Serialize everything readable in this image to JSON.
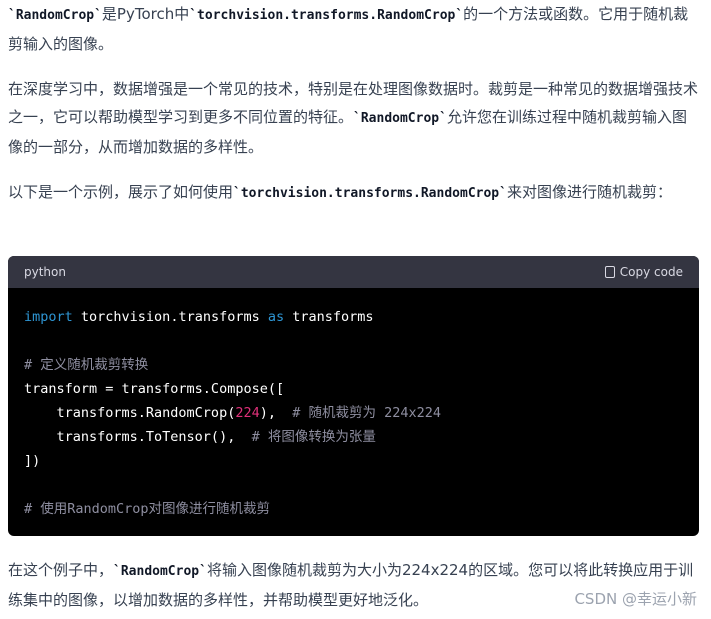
{
  "paragraph1": {
    "code1": "`RandomCrop`",
    "text1": "是PyTorch中",
    "code2": "`torchvision.transforms.RandomCrop`",
    "text2": "的一个方法或函数。它用于随机裁剪输入的图像。"
  },
  "paragraph2": {
    "text1": "在深度学习中，数据增强是一个常见的技术，特别是在处理图像数据时。裁剪是一种常见的数据增强技术之一，它可以帮助模型学习到更多不同位置的特征。",
    "code1": "`RandomCrop`",
    "text2": "允许您在训练过程中随机裁剪输入图像的一部分，从而增加数据的多样性。"
  },
  "paragraph3": {
    "text1": "以下是一个示例，展示了如何使用",
    "code1": "`torchvision.transforms.RandomCrop`",
    "text2": "来对图像进行随机裁剪："
  },
  "code_block": {
    "language": "python",
    "copy_label": "Copy code",
    "lines": {
      "l1": {
        "kw1": "import",
        "mid": " torchvision.transforms ",
        "kw2": "as",
        "end": " transforms"
      },
      "l2": "",
      "l3": {
        "comment": "# 定义随机裁剪转换"
      },
      "l4": {
        "text": "transform = transforms.Compose(["
      },
      "l5": {
        "pre": "    transforms.RandomCrop(",
        "num": "224",
        "post": "),  ",
        "comment": "# 随机裁剪为 224x224"
      },
      "l6": {
        "pre": "    transforms.ToTensor(),  ",
        "comment": "# 将图像转换为张量"
      },
      "l7": {
        "text": "])"
      },
      "l8": "",
      "l9": {
        "comment": "# 使用RandomCrop对图像进行随机裁剪"
      }
    }
  },
  "paragraph4": {
    "text1": "在这个例子中，",
    "code1": "`RandomCrop`",
    "text2": "将输入图像随机裁剪为大小为224x224的区域。您可以将此转换应用于训练集中的图像，以增加数据的多样性，并帮助模型更好地泛化。"
  },
  "watermark": "CSDN @幸运小新"
}
